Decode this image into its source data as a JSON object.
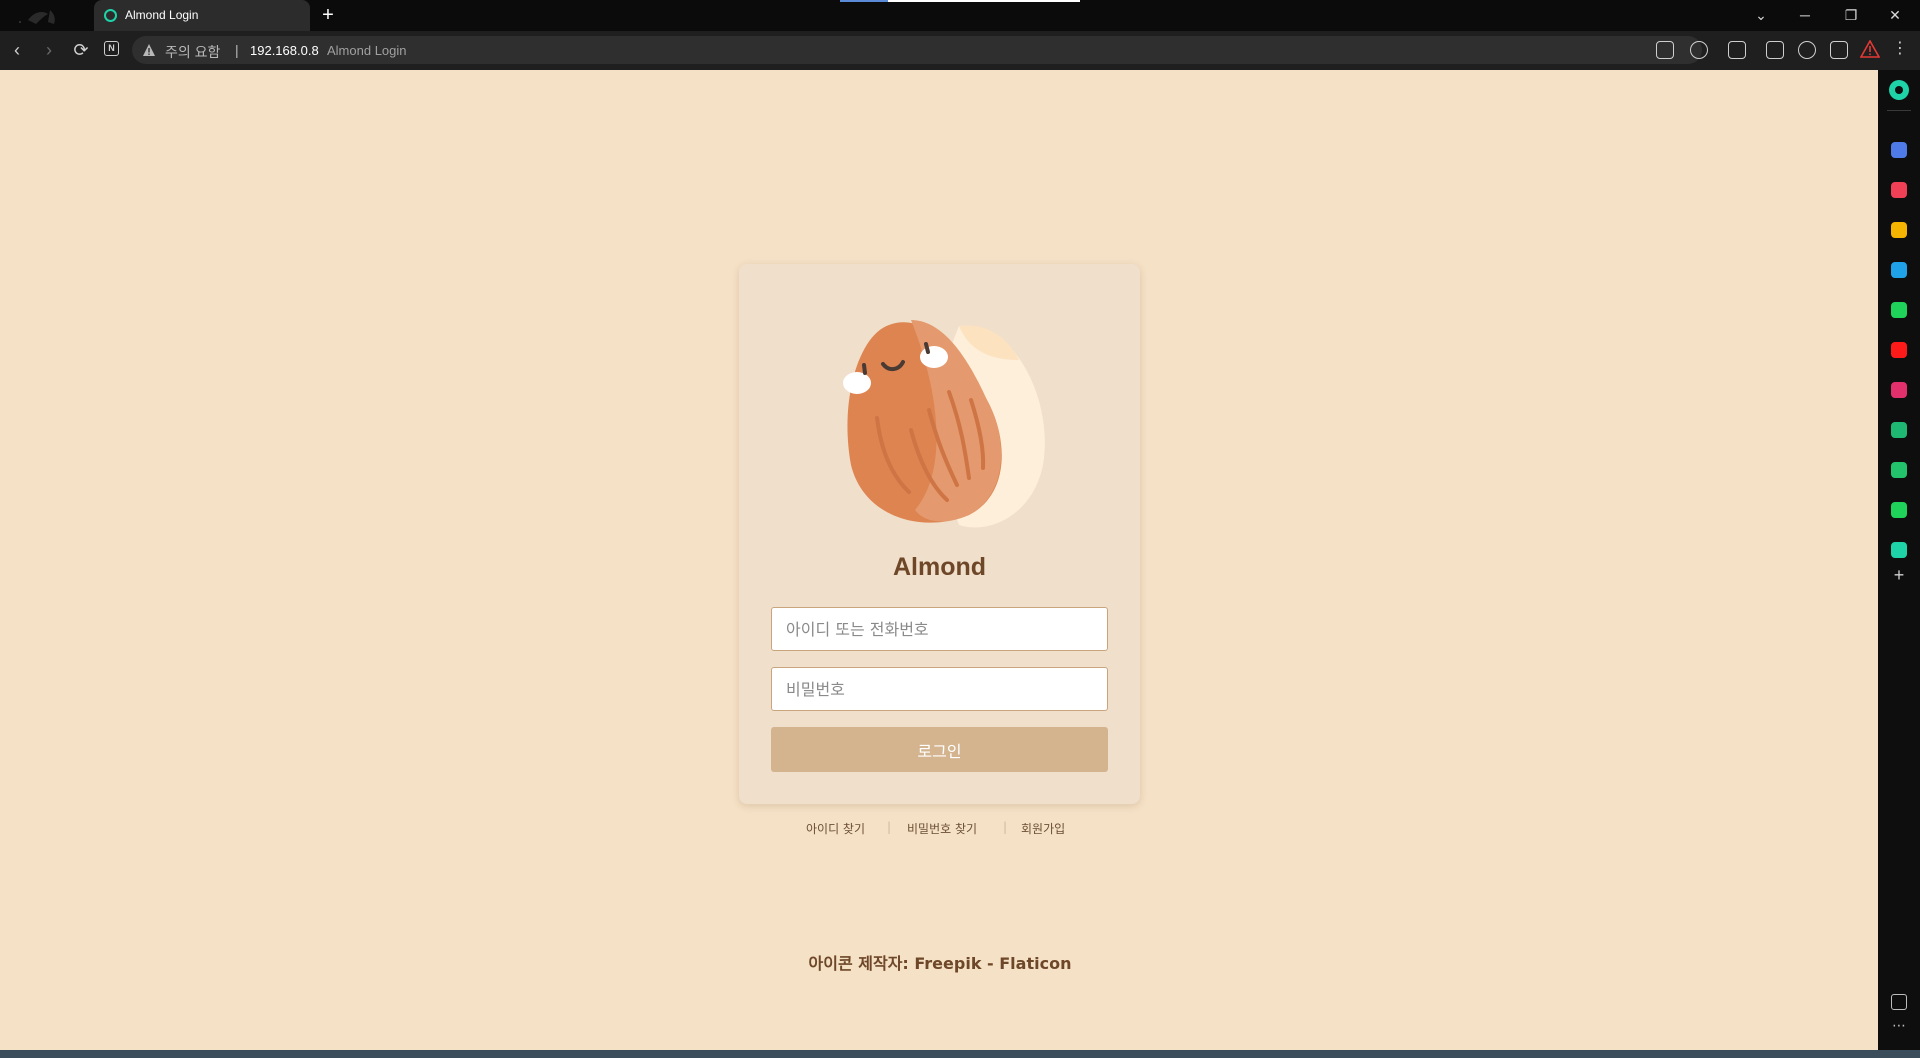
{
  "browser": {
    "tab": {
      "title": "Almond Login",
      "new_tab_icon": "+"
    },
    "window_controls": {
      "chevron": "⌄",
      "minimize": "─",
      "restore": "❐",
      "close": "✕"
    },
    "nav": {
      "back": "‹",
      "forward": "›",
      "reload": "⟳",
      "reader_badge": "N"
    },
    "omnibox": {
      "security_text": "주의 요함",
      "separator": "|",
      "url": "192.168.0.8",
      "page_title": "Almond Login"
    },
    "menu": "⋮",
    "accent": "#1ed3a8"
  },
  "sidebar": {
    "items": [
      {
        "name": "mail-app-icon",
        "color": "#4f7be8"
      },
      {
        "name": "pocket-app-icon",
        "color": "#ef4056"
      },
      {
        "name": "star-app-icon",
        "color": "#f5b400"
      },
      {
        "name": "edge-app-icon",
        "color": "#1fa2e8"
      },
      {
        "name": "webtoon-app-icon",
        "color": "#1fd35a"
      },
      {
        "name": "youtube-app-icon",
        "color": "#ff1a1a"
      },
      {
        "name": "instagram-app-icon",
        "color": "#e1306c"
      },
      {
        "name": "chart-app-icon",
        "color": "#1fb873"
      },
      {
        "name": "green-box-app-icon",
        "color": "#22c36b"
      },
      {
        "name": "play-app-icon",
        "color": "#1fd35a"
      },
      {
        "name": "teal-circle-app-icon",
        "color": "#1ed3a8"
      }
    ],
    "add": "+",
    "more": "⋯"
  },
  "login": {
    "brand": "Almond",
    "id_placeholder": "아이디 또는 전화번호",
    "password_placeholder": "비밀번호",
    "submit_label": "로그인",
    "links": {
      "find_id": "아이디 찾기",
      "find_password": "비밀번호 찾기",
      "signup": "회원가입",
      "divider": "|"
    },
    "credit": "아이콘 제작자: Freepik - Flaticon",
    "colors": {
      "background": "#f5e1c6",
      "card": "#f0dfcb",
      "button": "#d3b48e",
      "brand_text": "#6e4628"
    }
  }
}
